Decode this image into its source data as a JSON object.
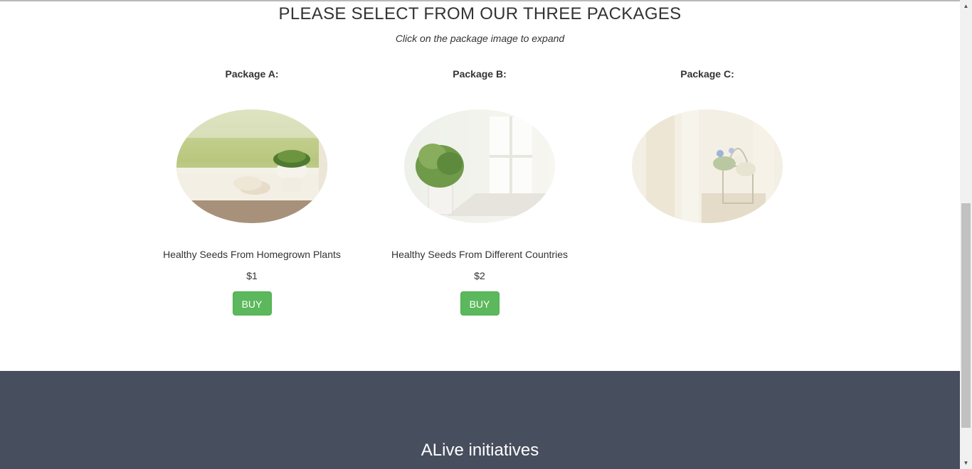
{
  "section": {
    "heading": "PLEASE SELECT FROM OUR THREE PACKAGES",
    "subheading": "Click on the package image to expand"
  },
  "packages": [
    {
      "title": "Package A:",
      "image_icon": "plant-on-windowsill-photo",
      "description": "Healthy Seeds From Homegrown Plants",
      "price": "$1",
      "buy_label": "BUY"
    },
    {
      "title": "Package B:",
      "image_icon": "potted-fern-photo",
      "description": "Healthy Seeds From Different Countries",
      "price": "$2",
      "buy_label": "BUY"
    },
    {
      "title": "Package C:",
      "image_icon": "flower-basket-photo"
    }
  ],
  "footer": {
    "title": "ALive initiatives"
  },
  "colors": {
    "buy_button": "#5cb85c",
    "footer_background": "#474e5d",
    "text": "#333333"
  },
  "scrollbar": {
    "up_icon": "scroll-up-arrow-icon",
    "down_icon": "scroll-down-arrow-icon"
  }
}
